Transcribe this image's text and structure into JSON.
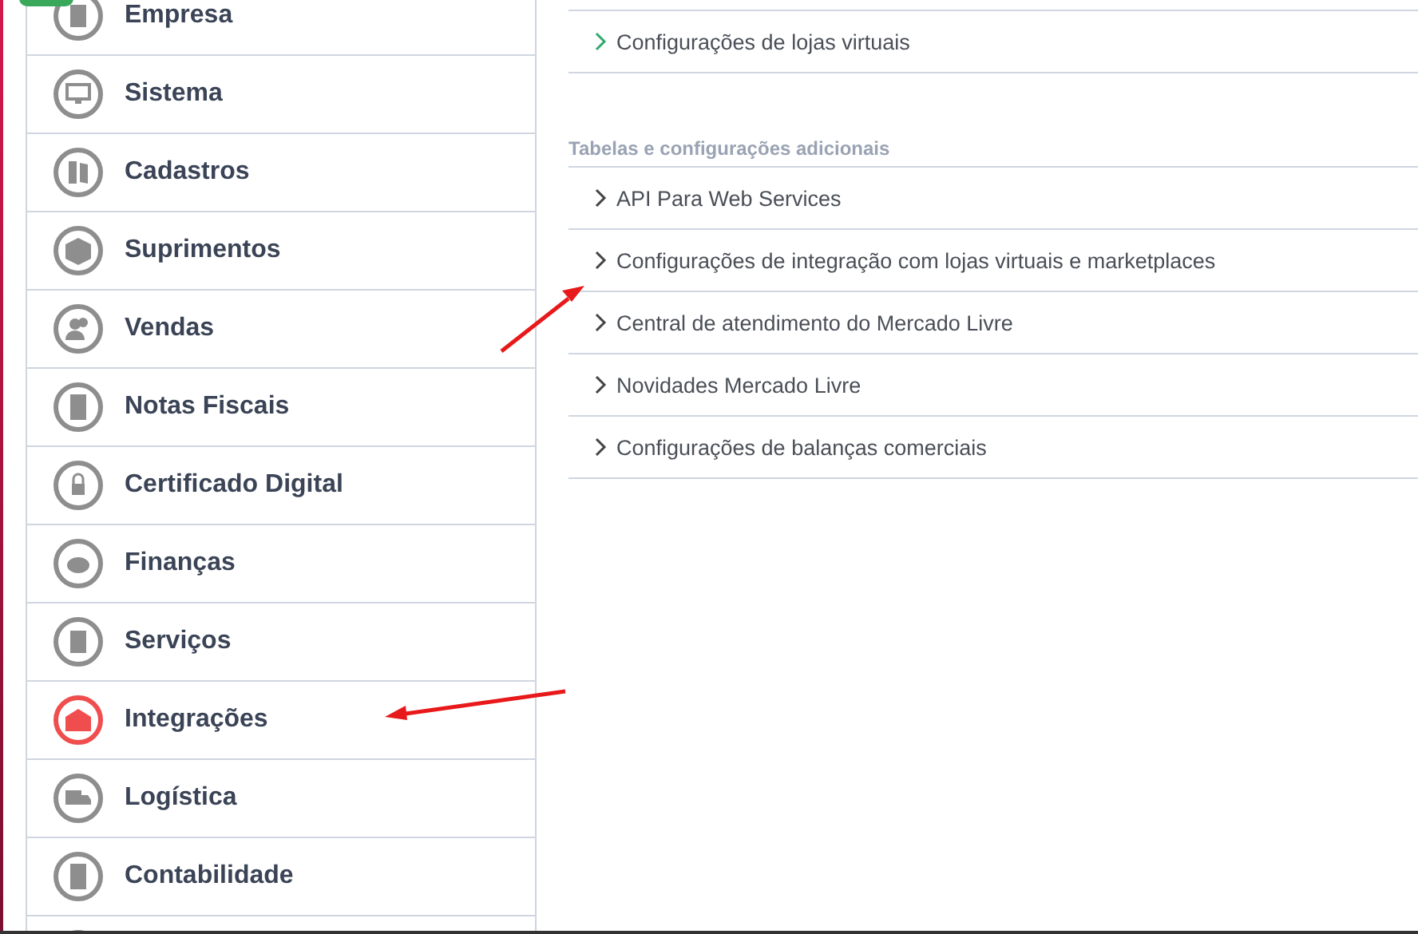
{
  "sidebar": {
    "items": [
      {
        "label": "Empresa",
        "selected": false
      },
      {
        "label": "Sistema",
        "selected": false
      },
      {
        "label": "Cadastros",
        "selected": false
      },
      {
        "label": "Suprimentos",
        "selected": false
      },
      {
        "label": "Vendas",
        "selected": false
      },
      {
        "label": "Notas Fiscais",
        "selected": false
      },
      {
        "label": "Certificado Digital",
        "selected": false
      },
      {
        "label": "Finanças",
        "selected": false
      },
      {
        "label": "Serviços",
        "selected": false
      },
      {
        "label": "Integrações",
        "selected": true
      },
      {
        "label": "Logística",
        "selected": false
      },
      {
        "label": "Contabilidade",
        "selected": false
      }
    ]
  },
  "top_links": [
    {
      "label": "Configurações de lojas virtuais",
      "selected": true
    }
  ],
  "section": {
    "title": "Tabelas e configurações adicionais",
    "links": [
      {
        "label": "API Para Web Services",
        "selected": false
      },
      {
        "label": "Configurações de integração com lojas virtuais e marketplaces",
        "selected": false
      },
      {
        "label": "Central de atendimento do Mercado Livre",
        "selected": false
      },
      {
        "label": "Novidades Mercado Livre",
        "selected": false
      },
      {
        "label": "Configurações de balanças comerciais",
        "selected": false
      }
    ]
  }
}
